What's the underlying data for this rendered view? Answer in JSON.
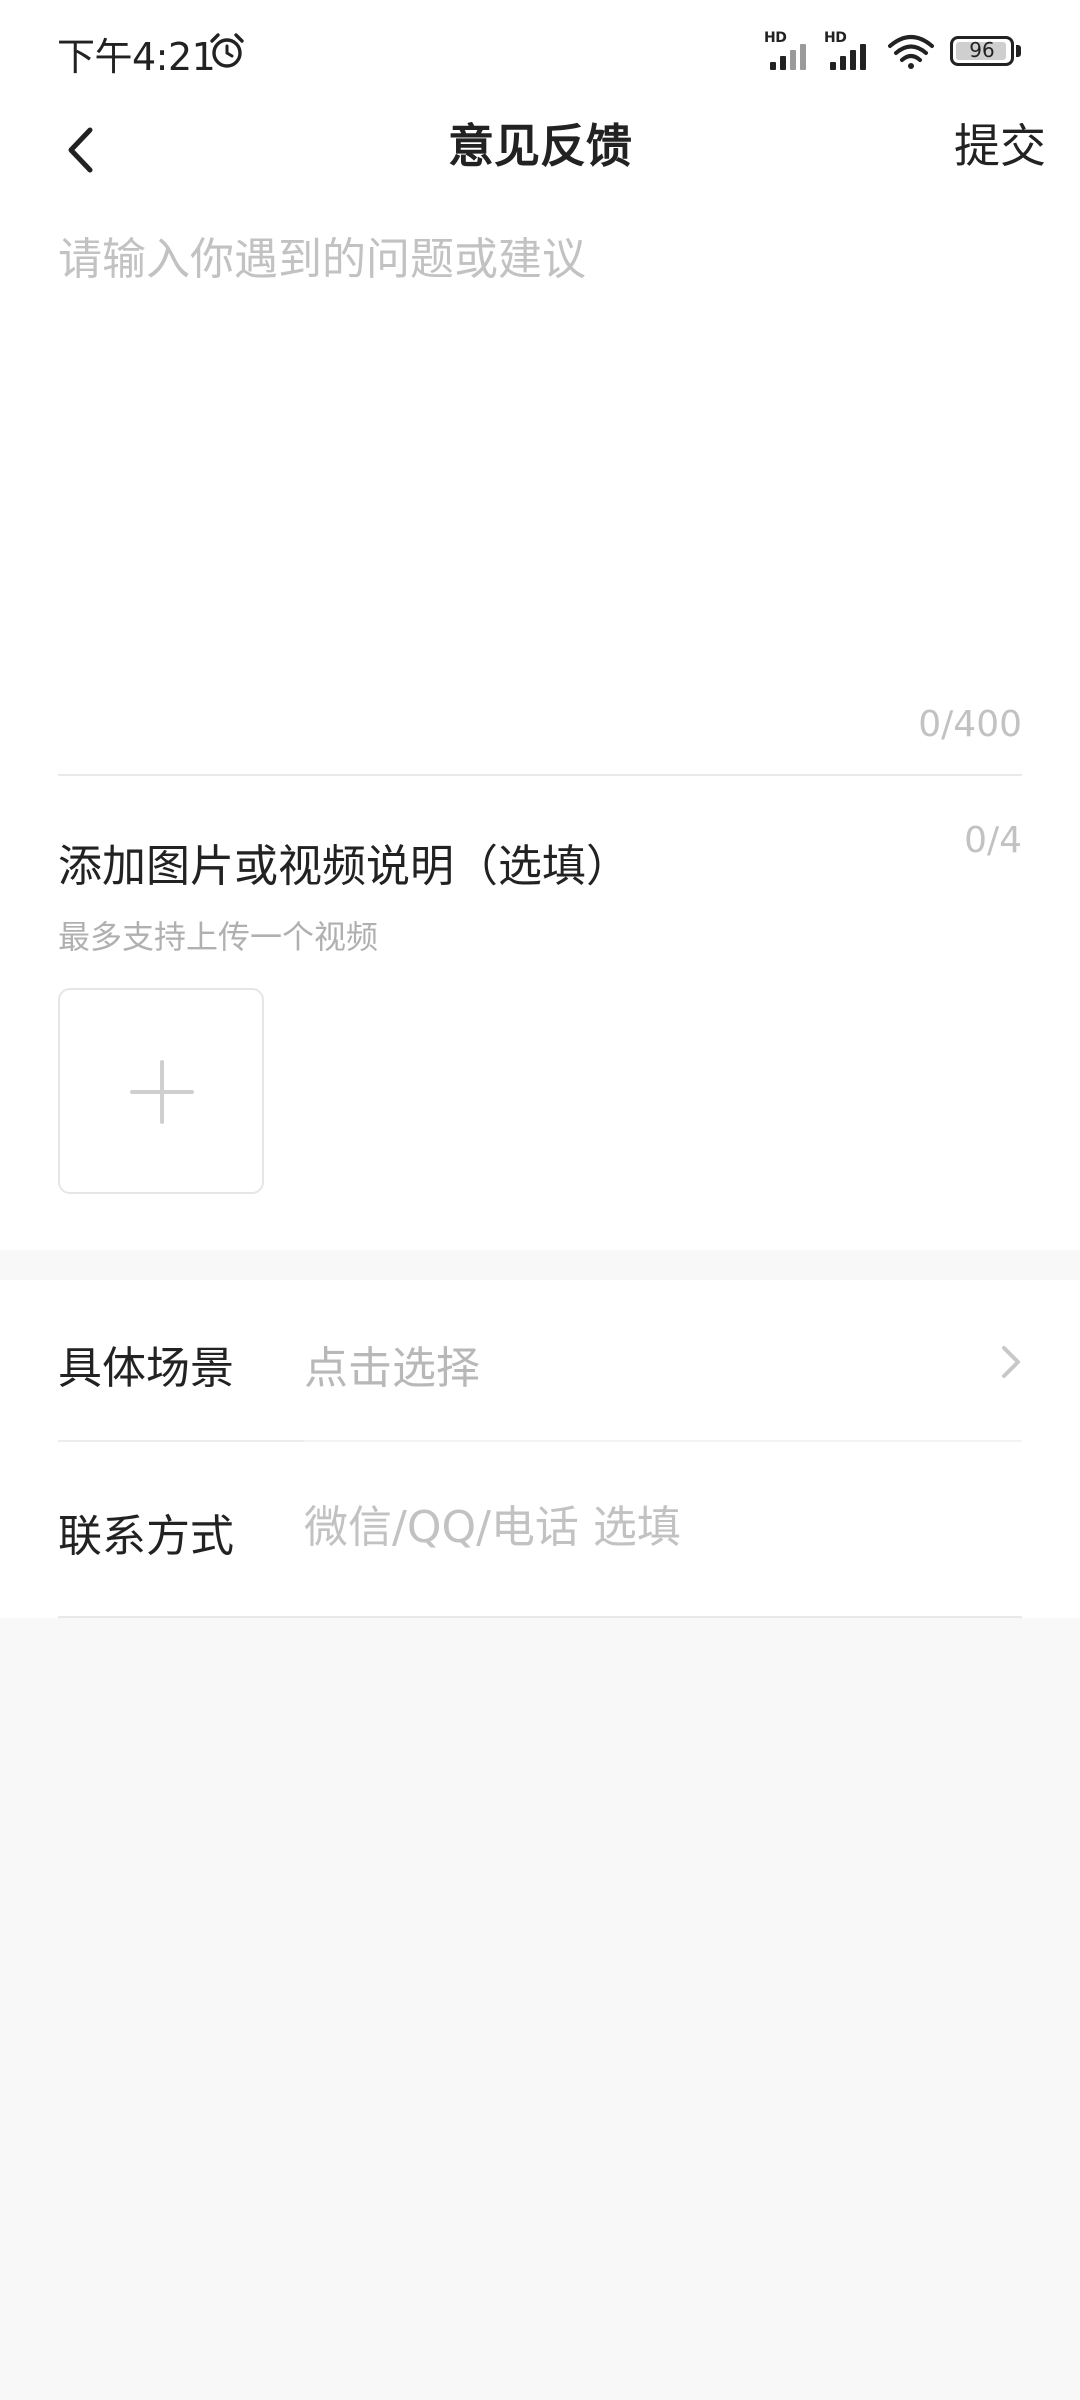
{
  "status_bar": {
    "time": "下午4:21",
    "network_1_label": "HD",
    "network_2_label": "HD",
    "battery_percent": "96",
    "battery_level": 0.96
  },
  "header": {
    "title": "意见反馈",
    "submit_label": "提交"
  },
  "feedback": {
    "placeholder": "请输入你遇到的问题或建议",
    "value": "",
    "counter": "0/400"
  },
  "attachments": {
    "title": "添加图片或视频说明（选填）",
    "counter": "0/4",
    "hint": "最多支持上传一个视频"
  },
  "form": {
    "scene_label": "具体场景",
    "scene_value": "点击选择",
    "contact_label": "联系方式",
    "contact_placeholder": "微信/QQ/电话 选填",
    "contact_value": ""
  },
  "colors": {
    "background": "#f8f8f8",
    "surface": "#ffffff",
    "text_primary": "#222222",
    "text_placeholder": "#c2c2c2",
    "divider": "#e9e9e9"
  }
}
